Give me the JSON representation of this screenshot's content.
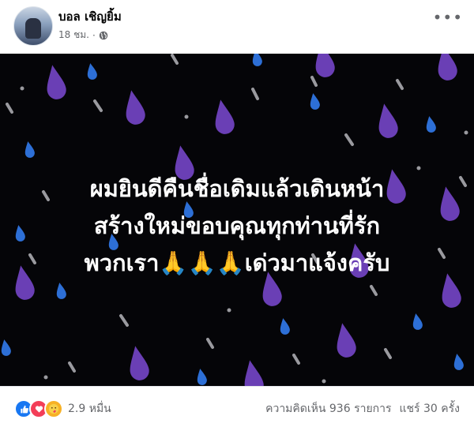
{
  "post": {
    "author": "บอล เชิญยิ้ม",
    "time": "18 ชม.",
    "separator": "·",
    "more_label": "•••"
  },
  "image": {
    "lines": [
      "ผมยินดีคืนชื่อเดิมแล้วเดินหน้า",
      "สร้างใหม่ขอบคุณทุกท่านที่รัก",
      "พวกเรา🙏🙏🙏เด่วมาแจ้งครับ"
    ]
  },
  "footer": {
    "reaction_count": "2.9 หมื่น",
    "comments": "ความคิดเห็น 936 รายการ",
    "shares": "แชร์ 30 ครั้ง"
  },
  "colors": {
    "background": "#050508",
    "drop_purple": "#6a3fb5",
    "drop_blue": "#2d6fd6",
    "drop_grey": "#9a9a9f"
  }
}
